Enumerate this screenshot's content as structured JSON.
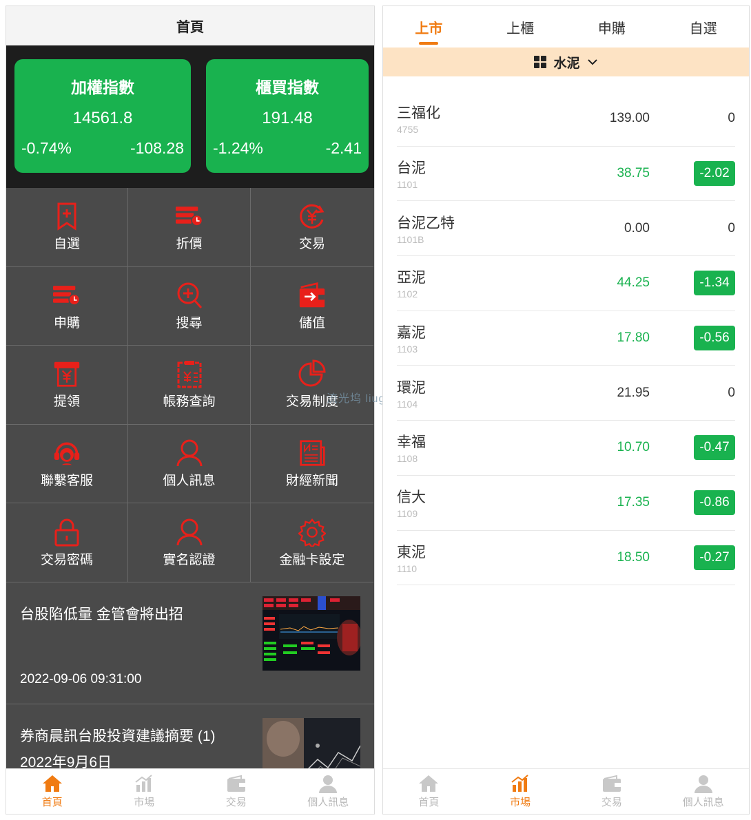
{
  "left": {
    "header_title": "首頁",
    "indices": [
      {
        "title": "加權指數",
        "value": "14561.8",
        "pct": "-0.74%",
        "change": "-108.28"
      },
      {
        "title": "櫃買指數",
        "value": "191.48",
        "pct": "-1.24%",
        "change": "-2.41"
      }
    ],
    "menu": [
      {
        "label": "自選",
        "icon": "bookmark-plus-icon"
      },
      {
        "label": "折價",
        "icon": "discount-stack-icon"
      },
      {
        "label": "交易",
        "icon": "yen-cycle-icon"
      },
      {
        "label": "申購",
        "icon": "subscribe-stack-icon"
      },
      {
        "label": "搜尋",
        "icon": "search-plus-icon"
      },
      {
        "label": "儲值",
        "icon": "wallet-icon"
      },
      {
        "label": "提領",
        "icon": "withdraw-icon"
      },
      {
        "label": "帳務查詢",
        "icon": "clipboard-yen-icon"
      },
      {
        "label": "交易制度",
        "icon": "pie-chart-icon"
      },
      {
        "label": "聯繫客服",
        "icon": "headset-icon"
      },
      {
        "label": "個人訊息",
        "icon": "user-icon"
      },
      {
        "label": "財經新聞",
        "icon": "newspaper-icon"
      },
      {
        "label": "交易密碼",
        "icon": "lock-icon"
      },
      {
        "label": "實名認證",
        "icon": "user-verify-icon"
      },
      {
        "label": "金融卡設定",
        "icon": "gear-icon"
      }
    ],
    "news": [
      {
        "title": "台股陷低量 金管會將出招",
        "time": "2022-09-06 09:31:00"
      },
      {
        "title": "券商晨訊台股投資建議摘要 (1) 2022年9月6日",
        "time": ""
      }
    ],
    "tabbar": [
      {
        "label": "首頁",
        "icon": "home-icon",
        "active": true
      },
      {
        "label": "市場",
        "icon": "market-chart-icon",
        "active": false
      },
      {
        "label": "交易",
        "icon": "trade-wallet-icon",
        "active": false
      },
      {
        "label": "個人訊息",
        "icon": "user-icon",
        "active": false
      }
    ]
  },
  "right": {
    "tabs": [
      {
        "label": "上市",
        "active": true
      },
      {
        "label": "上櫃",
        "active": false
      },
      {
        "label": "申購",
        "active": false
      },
      {
        "label": "自選",
        "active": false
      }
    ],
    "category": "水泥",
    "stocks": [
      {
        "name": "三福化",
        "code": "4755",
        "price": "139.00",
        "change": "0",
        "dir": "flat"
      },
      {
        "name": "台泥",
        "code": "1101",
        "price": "38.75",
        "change": "-2.02",
        "dir": "down"
      },
      {
        "name": "台泥乙特",
        "code": "1101B",
        "price": "0.00",
        "change": "0",
        "dir": "flat"
      },
      {
        "name": "亞泥",
        "code": "1102",
        "price": "44.25",
        "change": "-1.34",
        "dir": "down"
      },
      {
        "name": "嘉泥",
        "code": "1103",
        "price": "17.80",
        "change": "-0.56",
        "dir": "down"
      },
      {
        "name": "環泥",
        "code": "1104",
        "price": "21.95",
        "change": "0",
        "dir": "flat"
      },
      {
        "name": "幸福",
        "code": "1108",
        "price": "10.70",
        "change": "-0.47",
        "dir": "down"
      },
      {
        "name": "信大",
        "code": "1109",
        "price": "17.35",
        "change": "-0.86",
        "dir": "down"
      },
      {
        "name": "東泥",
        "code": "1110",
        "price": "18.50",
        "change": "-0.27",
        "dir": "down"
      }
    ],
    "tabbar": [
      {
        "label": "首頁",
        "icon": "home-icon",
        "active": false
      },
      {
        "label": "市場",
        "icon": "market-chart-icon",
        "active": true
      },
      {
        "label": "交易",
        "icon": "trade-wallet-icon",
        "active": false
      },
      {
        "label": "個人訊息",
        "icon": "user-icon",
        "active": false
      }
    ]
  },
  "watermark": "流光坞 liuguangwu.top",
  "colors": {
    "accent": "#f07b12",
    "up_down_green": "#19b24f",
    "icon_red": "#e8201a",
    "category_bg": "#fde3c4"
  }
}
